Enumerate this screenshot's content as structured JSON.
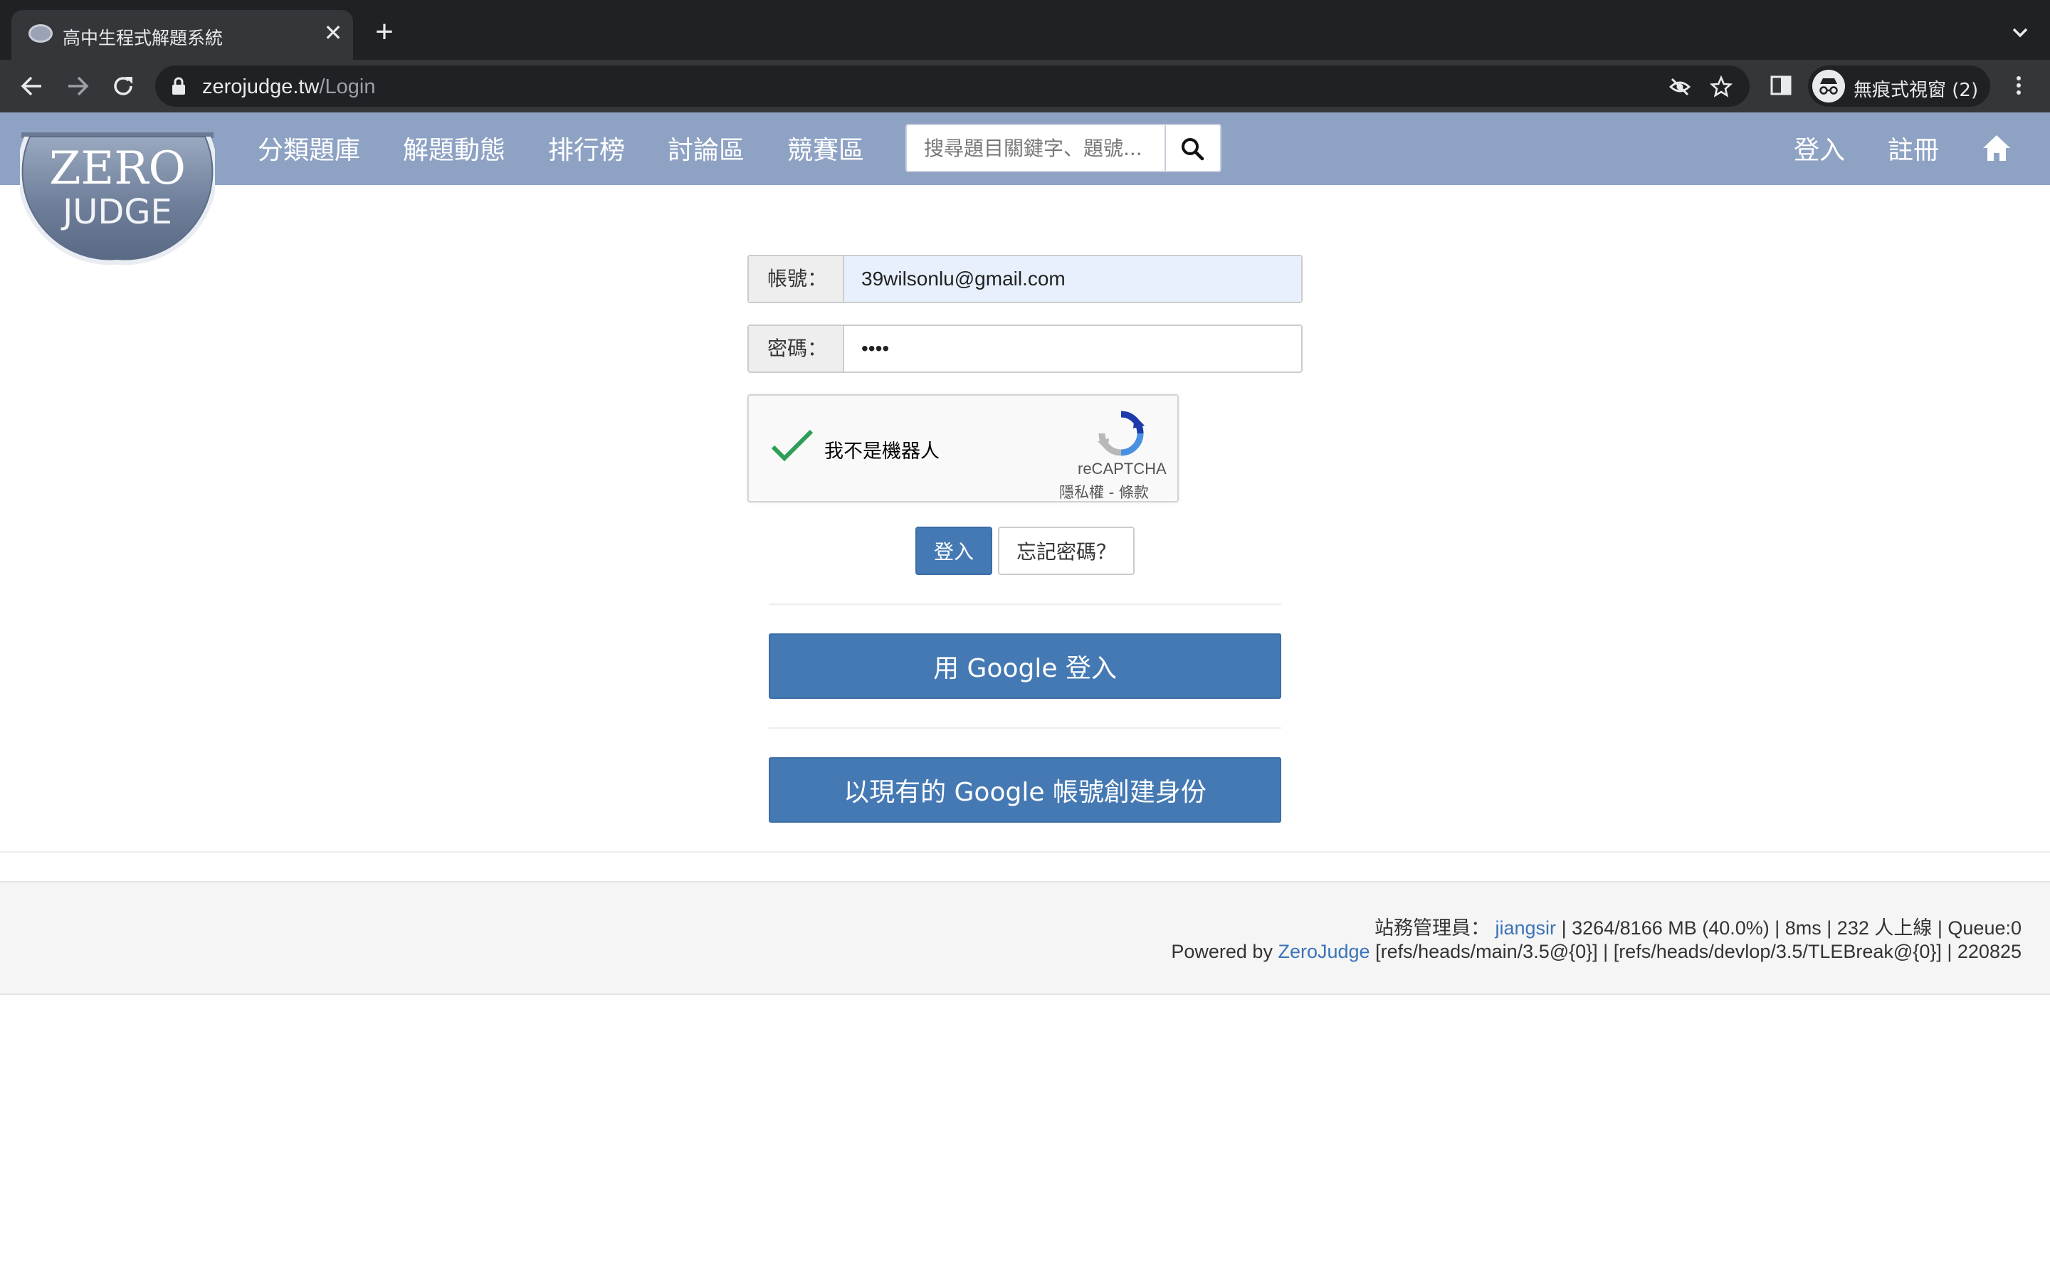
{
  "browser": {
    "tab_title": "高中生程式解題系統",
    "tab_close": "✕",
    "new_tab": "+",
    "url_host": "zerojudge.tw",
    "url_path": "/Login",
    "incognito_label": "無痕式視窗 (2)"
  },
  "site": {
    "logo_line1": "ZERO",
    "logo_line2": "JUDGE",
    "nav": [
      "分類題庫",
      "解題動態",
      "排行榜",
      "討論區",
      "競賽區"
    ],
    "search_placeholder": "搜尋題目關鍵字、題號...",
    "login": "登入",
    "register": "註冊"
  },
  "form": {
    "account_label": "帳號：",
    "account_value": "39wilsonlu@gmail.com",
    "password_label": "密碼：",
    "password_value": "••••",
    "captcha_label": "我不是機器人",
    "captcha_brand": "reCAPTCHA",
    "captcha_links": "隱私權 - 條款",
    "login_button": "登入",
    "forgot_button": "忘記密碼？",
    "google_login": "用 Google 登入",
    "google_create": "以現有的 Google 帳號創建身份"
  },
  "footer": {
    "admin_label": "站務管理員：",
    "admin_name": "jiangsir",
    "stats_memory": "| 3264/8166 MB (40.0%) | 8ms | 232",
    "stats_online": "人上線",
    "stats_queue": "| Queue:0",
    "powered_by": "Powered by",
    "powered_link": "ZeroJudge",
    "build_info": "[refs/heads/main/3.5@{0}] | [refs/heads/devlop/3.5/TLEBreak@{0}] | 220825"
  },
  "colors": {
    "navbar": "#8ea2c4",
    "primary_button": "#4579b3",
    "link": "#3b73b9",
    "autofill": "#e8f0fe"
  }
}
